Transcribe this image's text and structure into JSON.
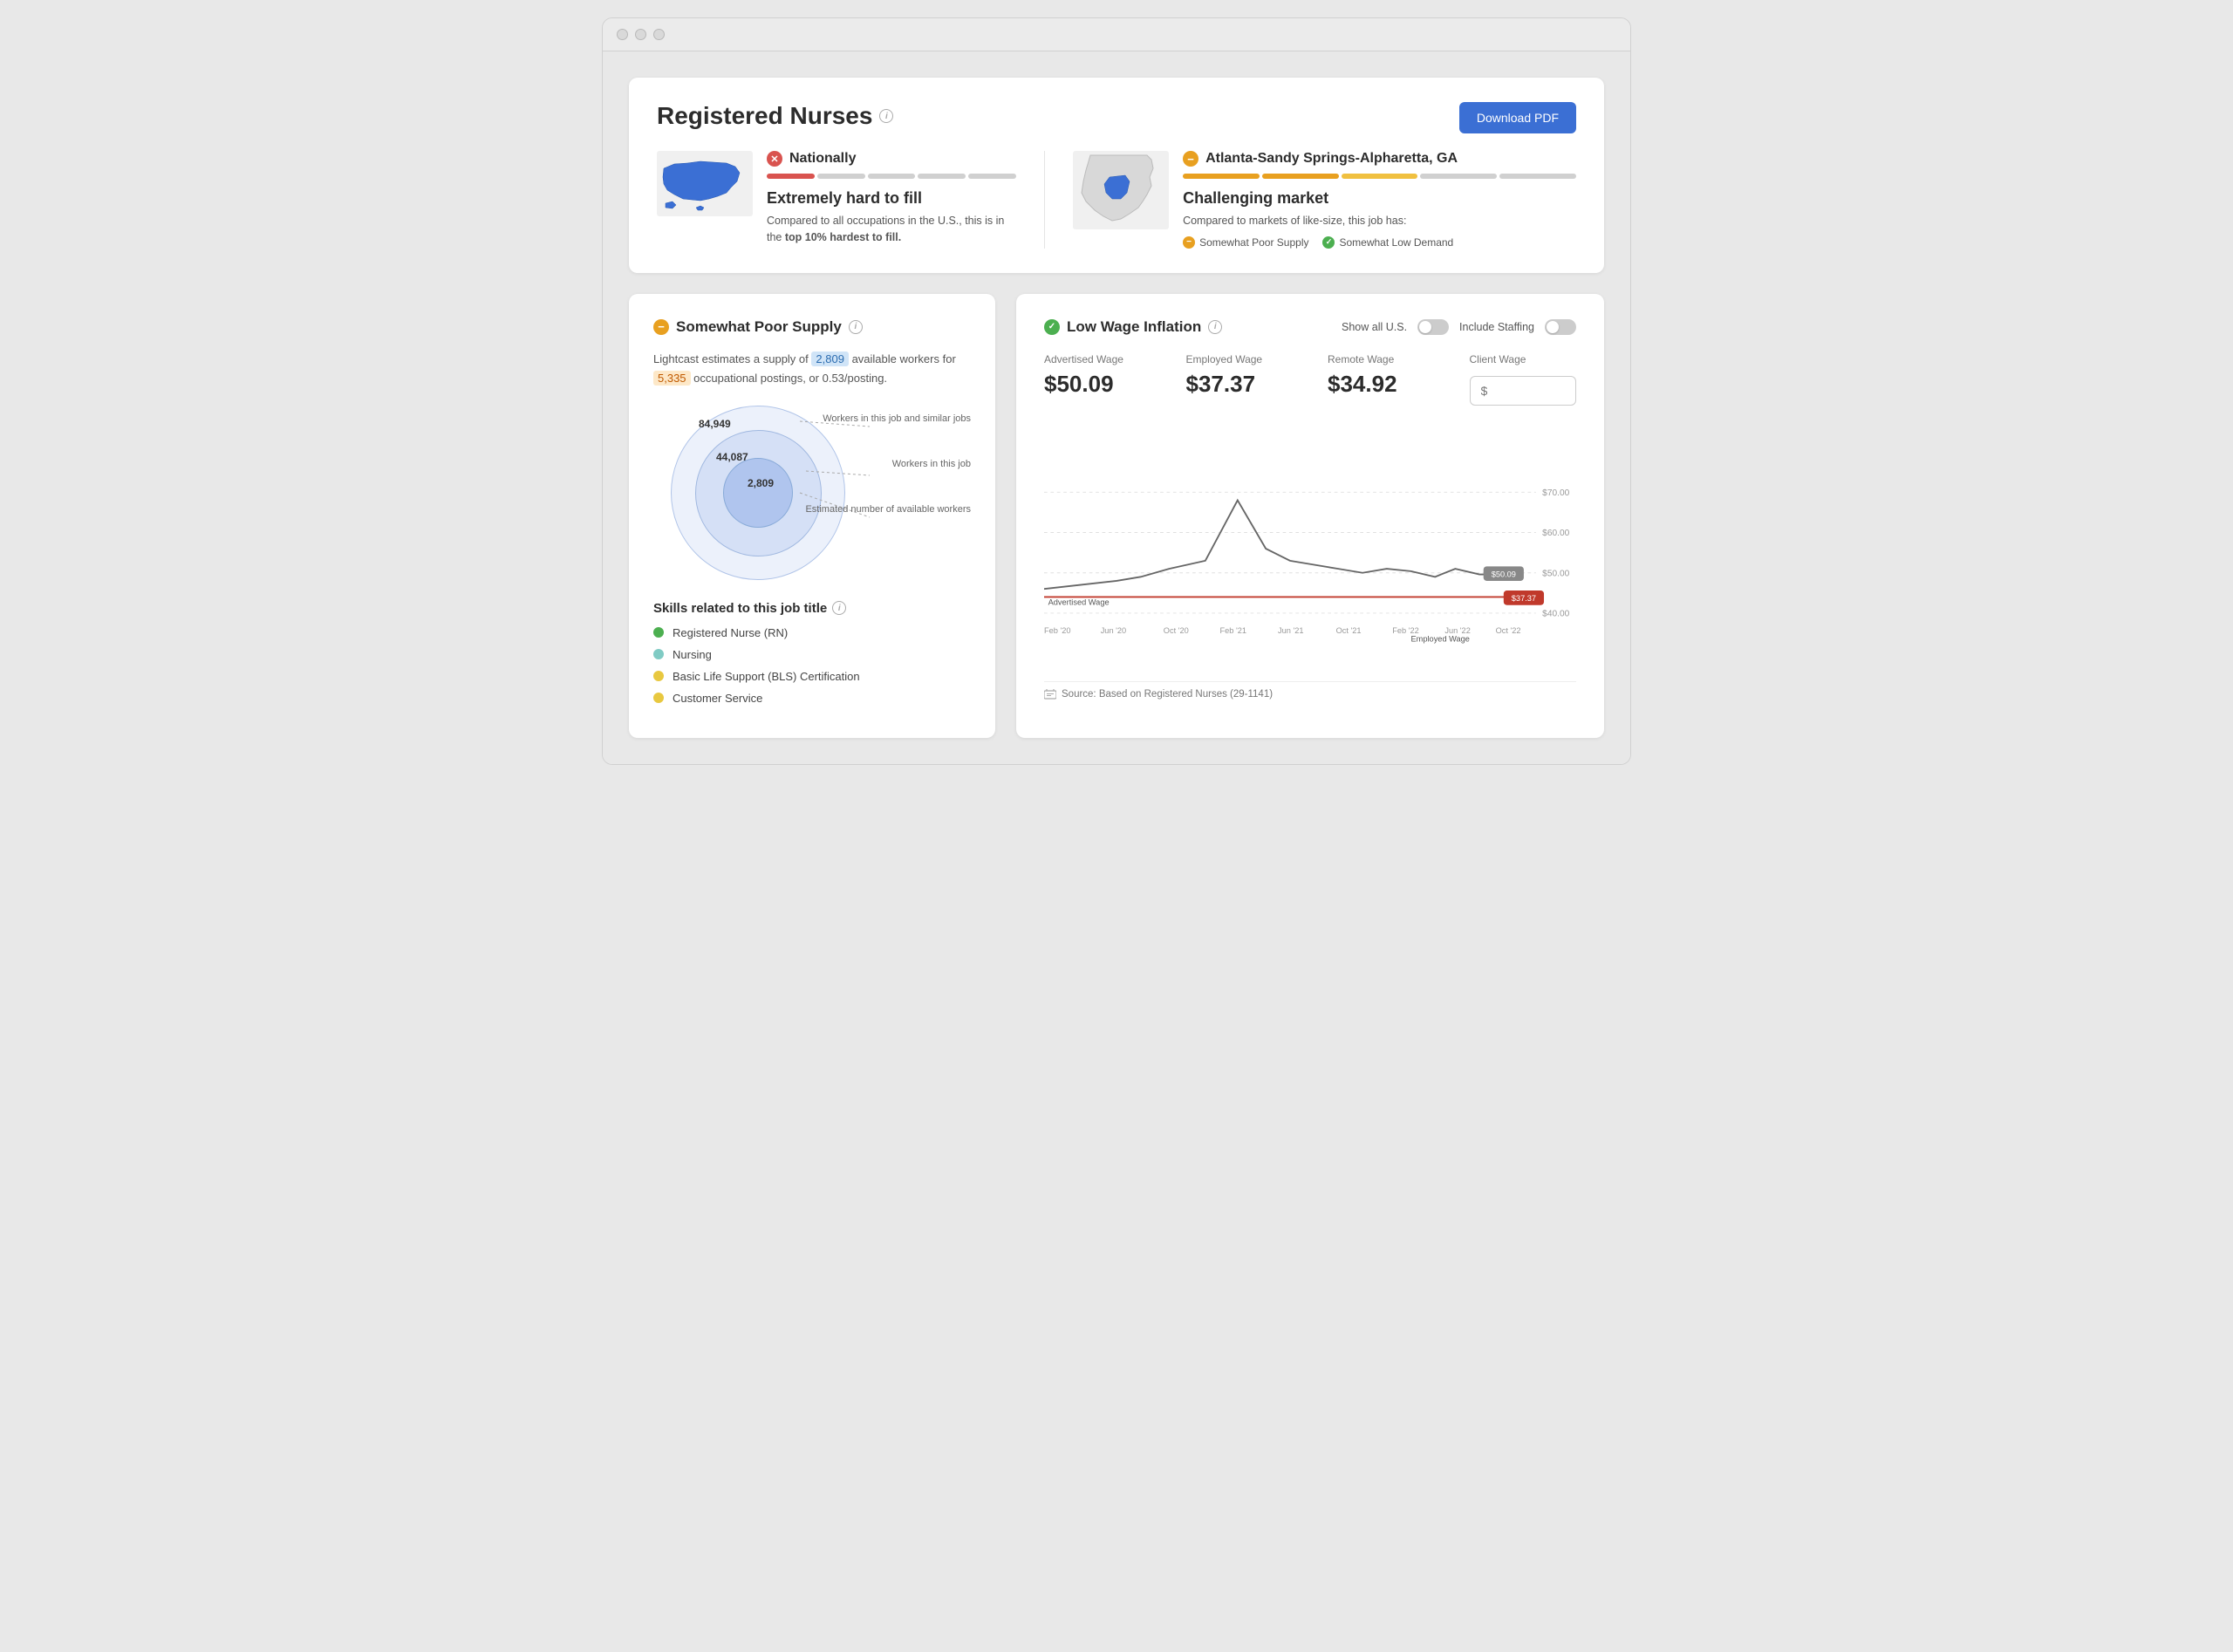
{
  "window": {
    "title": "Registered Nurses"
  },
  "header": {
    "title": "Registered Nurses",
    "download_btn": "Download PDF"
  },
  "national": {
    "label": "Nationally",
    "status_title": "Extremely hard to fill",
    "status_desc": "Compared to all occupations in the U.S., this is in the",
    "status_bold": "top 10% hardest to fill."
  },
  "local": {
    "label": "Atlanta-Sandy Springs-Alpharetta, GA",
    "status_title": "Challenging market",
    "status_desc": "Compared to markets of like-size, this job has:",
    "supply_label": "Somewhat Poor Supply",
    "demand_label": "Somewhat Low Demand"
  },
  "supply_panel": {
    "title": "Somewhat Poor Supply",
    "desc_prefix": "Lightcast estimates a supply of",
    "supply_num": "2,809",
    "desc_mid": "available workers for",
    "postings_num": "5,335",
    "desc_suffix": "occupational postings, or 0.53/posting.",
    "venn": {
      "outer_label": "84,949",
      "outer_desc": "Workers in this job and similar jobs",
      "mid_label": "44,087",
      "mid_desc": "Workers in this job",
      "inner_label": "2,809",
      "inner_desc": "Estimated number of available workers"
    }
  },
  "skills": {
    "title": "Skills related to this job title",
    "items": [
      {
        "label": "Registered Nurse (RN)",
        "color": "#4caf50"
      },
      {
        "label": "Nursing",
        "color": "#80cbc4"
      },
      {
        "label": "Basic Life Support (BLS) Certification",
        "color": "#e8c840"
      },
      {
        "label": "Customer Service",
        "color": "#e8c840"
      }
    ]
  },
  "wage_panel": {
    "title": "Low Wage Inflation",
    "show_all_us_label": "Show all U.S.",
    "include_staffing_label": "Include Staffing",
    "advertised_wage_label": "Advertised Wage",
    "employed_wage_label": "Employed Wage",
    "remote_wage_label": "Remote Wage",
    "client_wage_label": "Client Wage",
    "advertised_wage_value": "$50.09",
    "employed_wage_value": "$37.37",
    "remote_wage_value": "$34.92",
    "client_wage_placeholder": "$",
    "chart": {
      "x_labels": [
        "Feb '20",
        "Jun '20",
        "Oct '20",
        "Feb '21",
        "Jun '21",
        "Oct '21",
        "Feb '22",
        "Jun '22",
        "Oct '22"
      ],
      "y_labels": [
        "$40.00",
        "$50.00",
        "$60.00",
        "$70.00"
      ],
      "advertised_label": "Advertised Wage",
      "employed_label": "Employed Wage",
      "advertised_end_badge": "$50.09",
      "employed_end_badge": "$37.37"
    },
    "source": "Source: Based on Registered Nurses (29-1141)"
  }
}
